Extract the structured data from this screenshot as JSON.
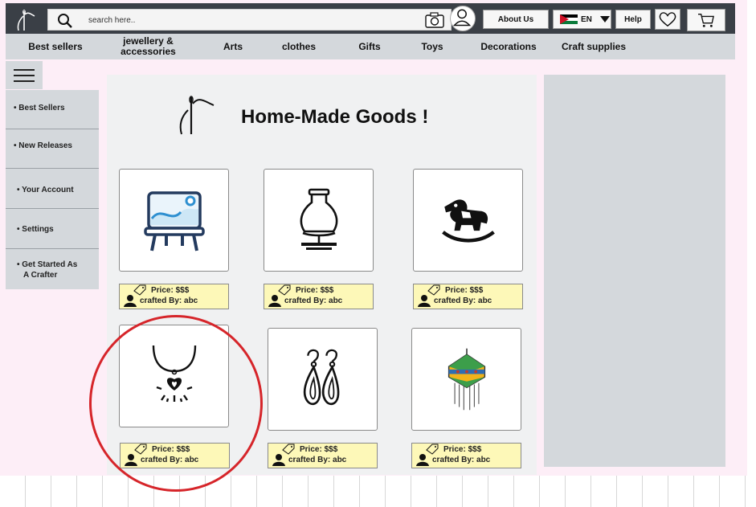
{
  "header": {
    "search_placeholder": "search here..",
    "about_label": "About Us",
    "lang_label": "EN",
    "help_label": "Help"
  },
  "categories": [
    "Best sellers",
    "jewellery &\naccessories",
    "Arts",
    "clothes",
    "Gifts",
    "Toys",
    "Decorations",
    "Craft supplies"
  ],
  "sidebar": {
    "items": [
      {
        "label": "• Best Sellers"
      },
      {
        "label": "• New Releases"
      },
      {
        "label": "• Your Account"
      },
      {
        "label": "• Settings"
      },
      {
        "label": "• Get Started As\n   A Crafter"
      }
    ]
  },
  "main": {
    "title": "Home-Made Goods !",
    "products": [
      {
        "icon": "easel-icon",
        "price": "Price: $$$",
        "crafted_by": "crafted By: abc"
      },
      {
        "icon": "vase-icon",
        "price": "Price: $$$",
        "crafted_by": "crafted By: abc"
      },
      {
        "icon": "rocking-horse-icon",
        "price": "Price: $$$",
        "crafted_by": "crafted By: abc"
      },
      {
        "icon": "necklace-icon",
        "price": "Price: $$$",
        "crafted_by": "crafted By: abc"
      },
      {
        "icon": "earrings-icon",
        "price": "Price: $$$",
        "crafted_by": "crafted By: abc"
      },
      {
        "icon": "lantern-icon",
        "price": "Price: $$$",
        "crafted_by": "crafted By: abc"
      }
    ]
  },
  "colors": {
    "topbar": "#3a3f46",
    "nav": "#d4d8dc",
    "background": "#fdeef7",
    "tag": "#fdf8b8",
    "annotation": "#d6252a"
  }
}
